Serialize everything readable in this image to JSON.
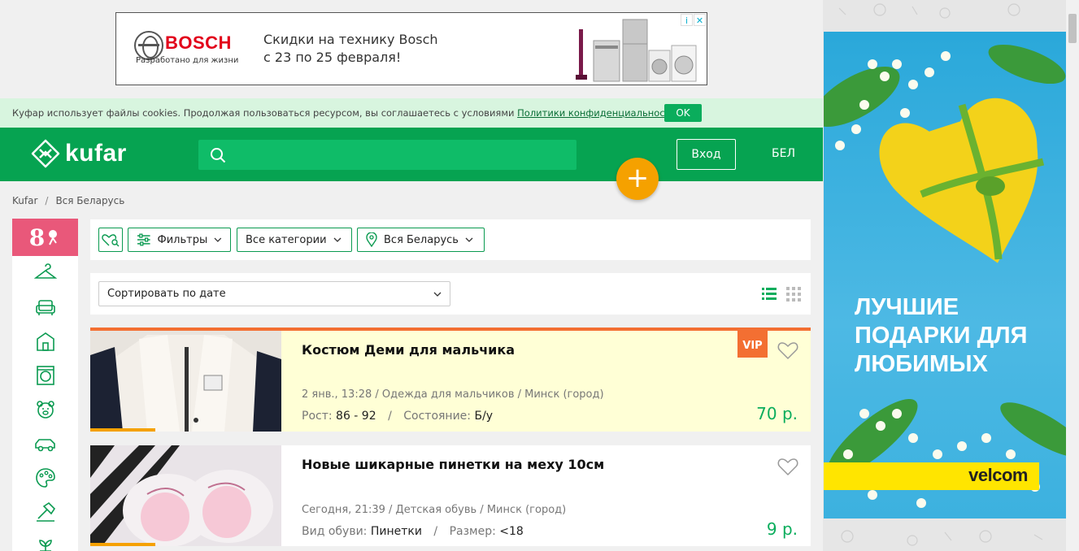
{
  "top_ad": {
    "brand": "BOSCH",
    "tagline": "Разработано для жизни",
    "line1": "Скидки на технику Bosch",
    "line2": "с 23 по 25 февраля!",
    "info_icon": "i",
    "close_icon": "✕"
  },
  "cookie": {
    "text": "Куфар использует файлы cookies. Продолжая пользоваться ресурсом, вы соглашаетесь с условиями ",
    "link": "Политики конфиденциальности",
    "tail": ".",
    "ok": "OK"
  },
  "header": {
    "logo": "kufar",
    "login": "Вход",
    "lang": "БЕЛ",
    "add": "+"
  },
  "breadcrumb": {
    "items": [
      "Kufar",
      "Вся Беларусь"
    ],
    "sep": "/"
  },
  "sidebar": {
    "promo": "8",
    "icons": [
      "hanger-icon",
      "armchair-icon",
      "house-icon",
      "washing-machine-icon",
      "teddy-bear-icon",
      "car-icon",
      "palette-icon",
      "hammer-icon",
      "plant-icon"
    ]
  },
  "filters": {
    "filters_label": "Фильтры",
    "category_label": "Все категории",
    "region_label": "Вся Беларусь"
  },
  "sort": {
    "selected": "Сортировать по дате"
  },
  "listings": [
    {
      "title": "Костюм Деми для мальчика",
      "meta": "2 янв., 13:28 / Одежда для мальчиков / Минск (город)",
      "param1_label": "Рост:",
      "param1_value": "86 - 92",
      "param2_label": "Состояние:",
      "param2_value": "Б/у",
      "price": "70 р.",
      "vip": "VIP"
    },
    {
      "title": "Новые шикарные пинетки на меху 10см",
      "meta": "Сегодня, 21:39 / Детская обувь / Минск (город)",
      "param1_label": "Вид обуви:",
      "param1_value": "Пинетки",
      "param2_label": "Размер:",
      "param2_value": "<18",
      "price": "9 р."
    }
  ],
  "right_ad": {
    "line1": "ЛУЧШИЕ",
    "line2": "ПОДАРКИ ДЛЯ",
    "line3": "ЛЮБИМЫХ",
    "brand": "velcom"
  },
  "colors": {
    "brand_green": "#06a351",
    "accent_orange": "#f5a100",
    "price_green": "#0aad5c",
    "vip_orange": "#f36f32"
  }
}
